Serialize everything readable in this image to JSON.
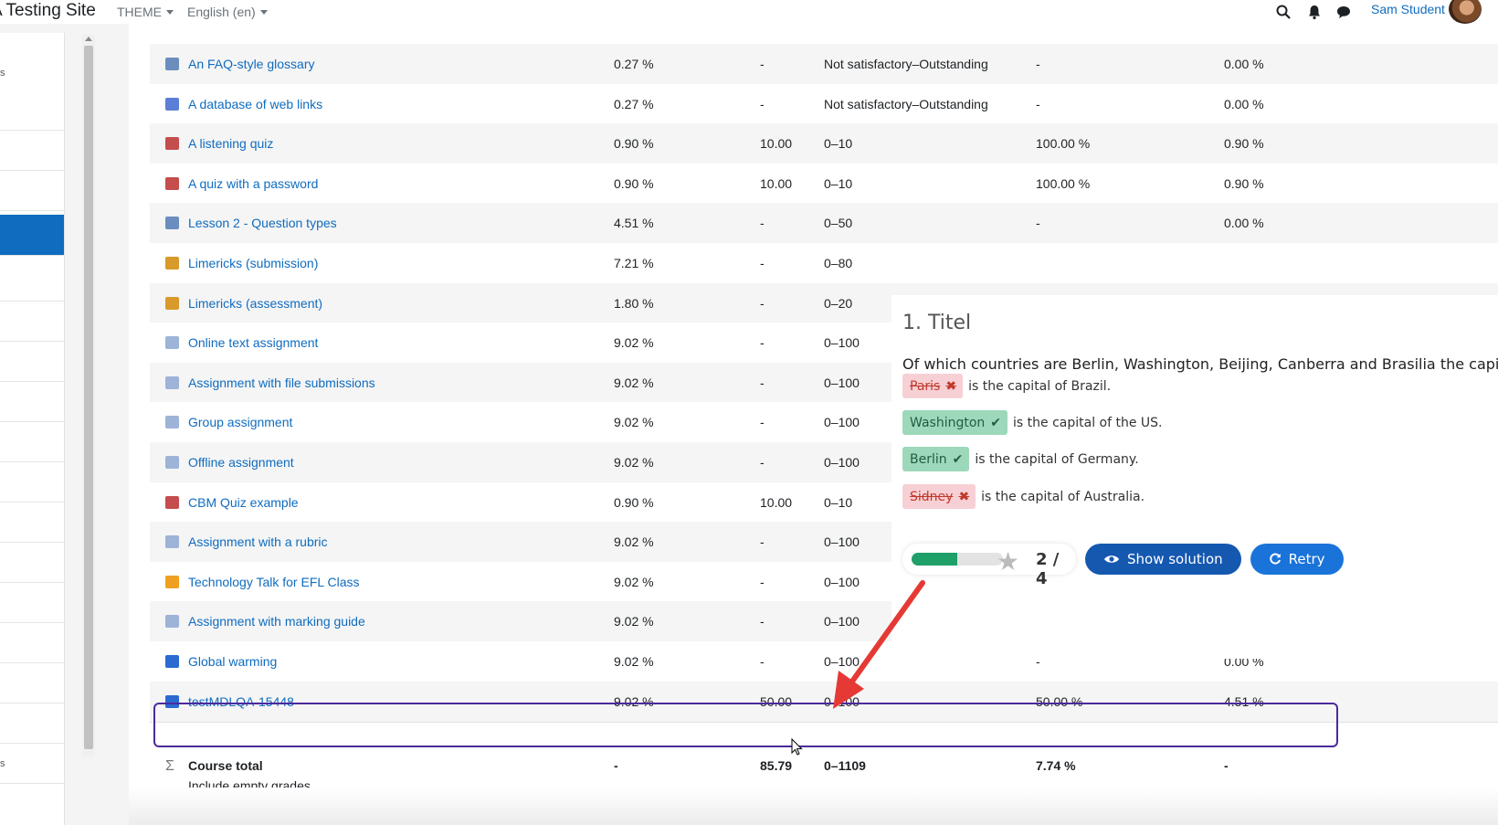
{
  "navbar": {
    "site_name": "A Testing Site",
    "theme_label": "THEME",
    "language_label": "English (en)",
    "user_name": "Sam Student"
  },
  "drawer": {
    "top_text": "s",
    "bottom_text": "s"
  },
  "grades": {
    "rows": [
      {
        "name": "An FAQ-style glossary",
        "icon": "glossary-icon",
        "weight": "0.27 %",
        "grade": "-",
        "range": "Not satisfactory–Outstanding",
        "percentage": "-",
        "contribution": "0.00 %"
      },
      {
        "name": "A database of web links",
        "icon": "database-icon",
        "weight": "0.27 %",
        "grade": "-",
        "range": "Not satisfactory–Outstanding",
        "percentage": "-",
        "contribution": "0.00 %"
      },
      {
        "name": "A listening quiz",
        "icon": "quiz-icon",
        "weight": "0.90 %",
        "grade": "10.00",
        "range": "0–10",
        "percentage": "100.00 %",
        "contribution": "0.90 %"
      },
      {
        "name": "A quiz with a password",
        "icon": "quiz-icon",
        "weight": "0.90 %",
        "grade": "10.00",
        "range": "0–10",
        "percentage": "100.00 %",
        "contribution": "0.90 %"
      },
      {
        "name": "Lesson 2 - Question types",
        "icon": "lesson-icon",
        "weight": "4.51 %",
        "grade": "-",
        "range": "0–50",
        "percentage": "-",
        "contribution": "0.00 %"
      },
      {
        "name": "Limericks (submission)",
        "icon": "workshop-icon",
        "weight": "7.21 %",
        "grade": "-",
        "range": "0–80",
        "percentage": "",
        "contribution": ""
      },
      {
        "name": "Limericks (assessment)",
        "icon": "workshop-icon",
        "weight": "1.80 %",
        "grade": "-",
        "range": "0–20",
        "percentage": "",
        "contribution": ""
      },
      {
        "name": "Online text assignment",
        "icon": "assignment-icon",
        "weight": "9.02 %",
        "grade": "-",
        "range": "0–100",
        "percentage": "",
        "contribution": ""
      },
      {
        "name": "Assignment with file submissions",
        "icon": "assignment-icon",
        "weight": "9.02 %",
        "grade": "-",
        "range": "0–100",
        "percentage": "",
        "contribution": ""
      },
      {
        "name": "Group assignment",
        "icon": "assignment-icon",
        "weight": "9.02 %",
        "grade": "-",
        "range": "0–100",
        "percentage": "",
        "contribution": ""
      },
      {
        "name": "Offline assignment",
        "icon": "assignment-icon",
        "weight": "9.02 %",
        "grade": "-",
        "range": "0–100",
        "percentage": "",
        "contribution": ""
      },
      {
        "name": "CBM Quiz example",
        "icon": "quiz-icon",
        "weight": "0.90 %",
        "grade": "10.00",
        "range": "0–10",
        "percentage": "",
        "contribution": ""
      },
      {
        "name": "Assignment with a rubric",
        "icon": "assignment-icon",
        "weight": "9.02 %",
        "grade": "-",
        "range": "0–100",
        "percentage": "",
        "contribution": ""
      },
      {
        "name": "Technology Talk for EFL Class",
        "icon": "external-tool-icon",
        "weight": "9.02 %",
        "grade": "-",
        "range": "0–100",
        "percentage": "",
        "contribution": ""
      },
      {
        "name": "Assignment with marking guide",
        "icon": "assignment-icon",
        "weight": "9.02 %",
        "grade": "-",
        "range": "0–100",
        "percentage": "",
        "contribution": ""
      },
      {
        "name": "Global warming",
        "icon": "h5p-icon",
        "weight": "9.02 %",
        "grade": "-",
        "range": "0–100",
        "percentage": "-",
        "contribution": "0.00 %"
      },
      {
        "name": "testMDLQA-15448",
        "icon": "h5p-icon",
        "weight": "9.02 %",
        "grade": "50.00",
        "range": "0–100",
        "percentage": "50.00 %",
        "contribution": "4.51 %"
      }
    ],
    "total": {
      "label": "Course total",
      "sub": "Include empty grades.",
      "weight": "-",
      "grade": "85.79",
      "range": "0–1109",
      "percentage": "7.74 %",
      "contribution": "-"
    }
  },
  "h5p": {
    "title": "1. Titel",
    "question": "Of which countries are Berlin, Washington, Beijing, Canberra and Brasilia the capita",
    "answers": [
      {
        "answer": "Paris",
        "correct": false,
        "rest": "is the capital of Brazil."
      },
      {
        "answer": "Washington",
        "correct": true,
        "rest": "is the capital of the US."
      },
      {
        "answer": "Berlin",
        "correct": true,
        "rest": "is the capital of Germany."
      },
      {
        "answer": "Sidney",
        "correct": false,
        "rest": "is the capital of Australia."
      }
    ],
    "score_text": "2 / 4",
    "score_fraction": 0.5,
    "show_solution_label": "Show solution",
    "retry_label": "Retry"
  },
  "colors": {
    "link": "#0f6cbf",
    "highlight_border": "#4b2a9e",
    "arrow": "#e53935",
    "correct_bg": "#9dd8bb",
    "wrong_bg": "#f7d0d5"
  }
}
